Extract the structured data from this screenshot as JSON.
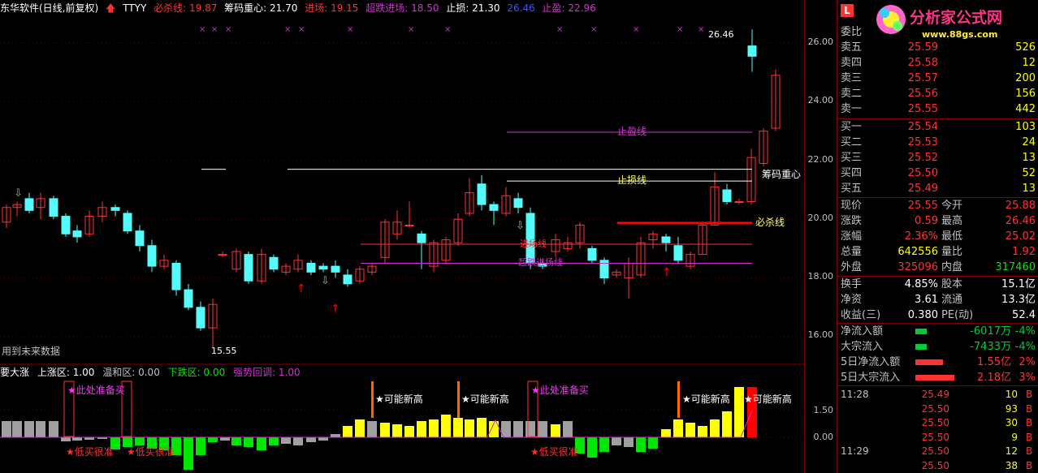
{
  "header": {
    "title": "东华软件(日线,前复权)",
    "indicator": "TTYY",
    "bisha_label": "必杀线: 19.87",
    "chouma_label": "筹码重心: 21.70",
    "jinchang_label": "进场: 19.15",
    "chaodie_label": "超跌进场: 18.50",
    "zhisun_label": "止损: 21.30",
    "extra_value": "26.46",
    "zhiying_label": "止盈: 22.96"
  },
  "price_axis": [
    "26.00",
    "24.00",
    "22.00",
    "20.00",
    "18.00",
    "16.00"
  ],
  "ind_axis": [
    "1.50",
    "0.00"
  ],
  "chart_annotations": {
    "high": "26.46",
    "low": "15.55",
    "zhiying_line": "止盈线",
    "zhisun_line": "止损线",
    "chouma_line": "筹码重心",
    "bisha_line": "必杀线",
    "jinchang_line": "进场线",
    "chaodie_line": "超跌进场线",
    "future_note": "用到未来数据"
  },
  "indicator": {
    "name": "要大涨",
    "up_zone": "上涨区: 1.00",
    "mild_zone": "温和区: 0.00",
    "down_zone": "下跌区: 0.00",
    "rebound": "强势回调: 1.00",
    "buy_prep": "★此处准备买",
    "low_buy": "★低买很准",
    "new_high": "★可能新高"
  },
  "panel": {
    "logo_text": "分析家公式网",
    "logo_url": "www.88gs.com",
    "weibi": "委比",
    "asks": [
      {
        "label": "卖五",
        "price": "25.59",
        "vol": "526"
      },
      {
        "label": "卖四",
        "price": "25.58",
        "vol": "12"
      },
      {
        "label": "卖三",
        "price": "25.57",
        "vol": "200"
      },
      {
        "label": "卖二",
        "price": "25.56",
        "vol": "156"
      },
      {
        "label": "卖一",
        "price": "25.55",
        "vol": "442"
      }
    ],
    "bids": [
      {
        "label": "买一",
        "price": "25.54",
        "vol": "103"
      },
      {
        "label": "买二",
        "price": "25.53",
        "vol": "24"
      },
      {
        "label": "买三",
        "price": "25.52",
        "vol": "13"
      },
      {
        "label": "买四",
        "price": "25.50",
        "vol": "52"
      },
      {
        "label": "买五",
        "price": "25.49",
        "vol": "13"
      }
    ],
    "stats": [
      {
        "k1": "现价",
        "v1": "25.55",
        "c1": "red",
        "k2": "今开",
        "v2": "25.88",
        "c2": "red"
      },
      {
        "k1": "涨跌",
        "v1": "0.59",
        "c1": "red",
        "k2": "最高",
        "v2": "26.46",
        "c2": "red"
      },
      {
        "k1": "涨幅",
        "v1": "2.36%",
        "c1": "red",
        "k2": "最低",
        "v2": "25.02",
        "c2": "red"
      },
      {
        "k1": "总量",
        "v1": "642556",
        "c1": "yellow",
        "k2": "量比",
        "v2": "1.92",
        "c2": "red"
      },
      {
        "k1": "外盘",
        "v1": "325096",
        "c1": "red",
        "k2": "内盘",
        "v2": "317460",
        "c2": "green"
      }
    ],
    "stats2": [
      {
        "k1": "换手",
        "v1": "4.85%",
        "k2": "股本",
        "v2": "15.1亿"
      },
      {
        "k1": "净资",
        "v1": "3.61",
        "k2": "流通",
        "v2": "13.3亿"
      },
      {
        "k1": "收益(三)",
        "v1": "0.380",
        "k2": "PE(动)",
        "v2": "52.4"
      }
    ],
    "flows": [
      {
        "label": "净流入额",
        "value": "-6017万",
        "pct": "-4%",
        "color": "green",
        "bar": 0.25
      },
      {
        "label": "大宗流入",
        "value": "-7433万",
        "pct": "-4%",
        "color": "green",
        "bar": 0.25
      },
      {
        "label": "5日净流入额",
        "value": "1.55亿",
        "pct": "2%",
        "color": "red",
        "bar": 0.6
      },
      {
        "label": "5日大宗流入",
        "value": "2.18亿",
        "pct": "3%",
        "color": "red",
        "bar": 0.85
      }
    ],
    "trades": [
      {
        "t": "11:28",
        "p": "25.49",
        "q": "10",
        "s": "B"
      },
      {
        "t": "",
        "p": "25.50",
        "q": "93",
        "s": "B"
      },
      {
        "t": "",
        "p": "25.50",
        "q": "30",
        "s": "B"
      },
      {
        "t": "",
        "p": "25.50",
        "q": "9",
        "s": "B"
      },
      {
        "t": "11:29",
        "p": "25.50",
        "q": "12",
        "s": "B"
      },
      {
        "t": "",
        "p": "25.50",
        "q": "38",
        "s": "B"
      }
    ]
  },
  "colors": {
    "up": "#ff3232",
    "down": "#54fcfc",
    "white": "#ffffff",
    "purple": "#cc33cc",
    "green": "#00e600",
    "yellow": "#ffff00",
    "gray": "#a0a0a0"
  }
}
